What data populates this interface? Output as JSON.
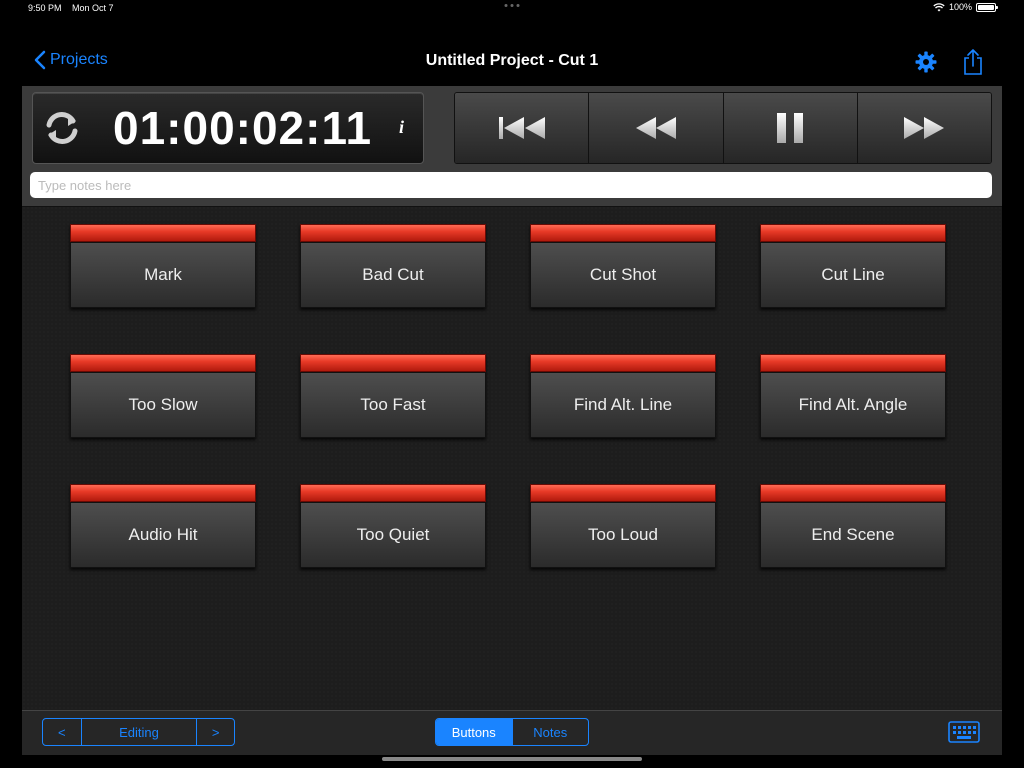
{
  "status": {
    "time": "9:50 PM",
    "date": "Mon Oct 7",
    "battery": "100%",
    "wifi_icon": "wifi-icon",
    "battery_icon": "battery-icon"
  },
  "nav": {
    "back_label": "Projects",
    "title": "Untitled Project - Cut 1",
    "settings_icon": "gear-icon",
    "share_icon": "share-icon",
    "accent_color": "#1a84ff"
  },
  "transport": {
    "timecode": "01:00:02:11",
    "info_label": "i",
    "sync_icon": "sync-icon",
    "buttons": [
      {
        "name": "skip-to-start",
        "icon": "skip-back-icon"
      },
      {
        "name": "rewind",
        "icon": "rewind-icon"
      },
      {
        "name": "pause",
        "icon": "pause-icon"
      },
      {
        "name": "fast-forward",
        "icon": "fast-forward-icon"
      }
    ]
  },
  "notes": {
    "placeholder": "Type notes here",
    "value": ""
  },
  "marks": [
    {
      "label": "Mark"
    },
    {
      "label": "Bad Cut"
    },
    {
      "label": "Cut Shot"
    },
    {
      "label": "Cut Line"
    },
    {
      "label": "Too Slow"
    },
    {
      "label": "Too Fast"
    },
    {
      "label": "Find Alt. Line"
    },
    {
      "label": "Find Alt. Angle"
    },
    {
      "label": "Audio Hit"
    },
    {
      "label": "Too Quiet"
    },
    {
      "label": "Too Loud"
    },
    {
      "label": "End Scene"
    }
  ],
  "mark_color": "#e83a27",
  "toolbar": {
    "prev_label": "<",
    "mode_label": "Editing",
    "next_label": ">",
    "tabs": [
      {
        "label": "Buttons",
        "active": true
      },
      {
        "label": "Notes",
        "active": false
      }
    ],
    "keyboard_icon": "keyboard-icon"
  }
}
